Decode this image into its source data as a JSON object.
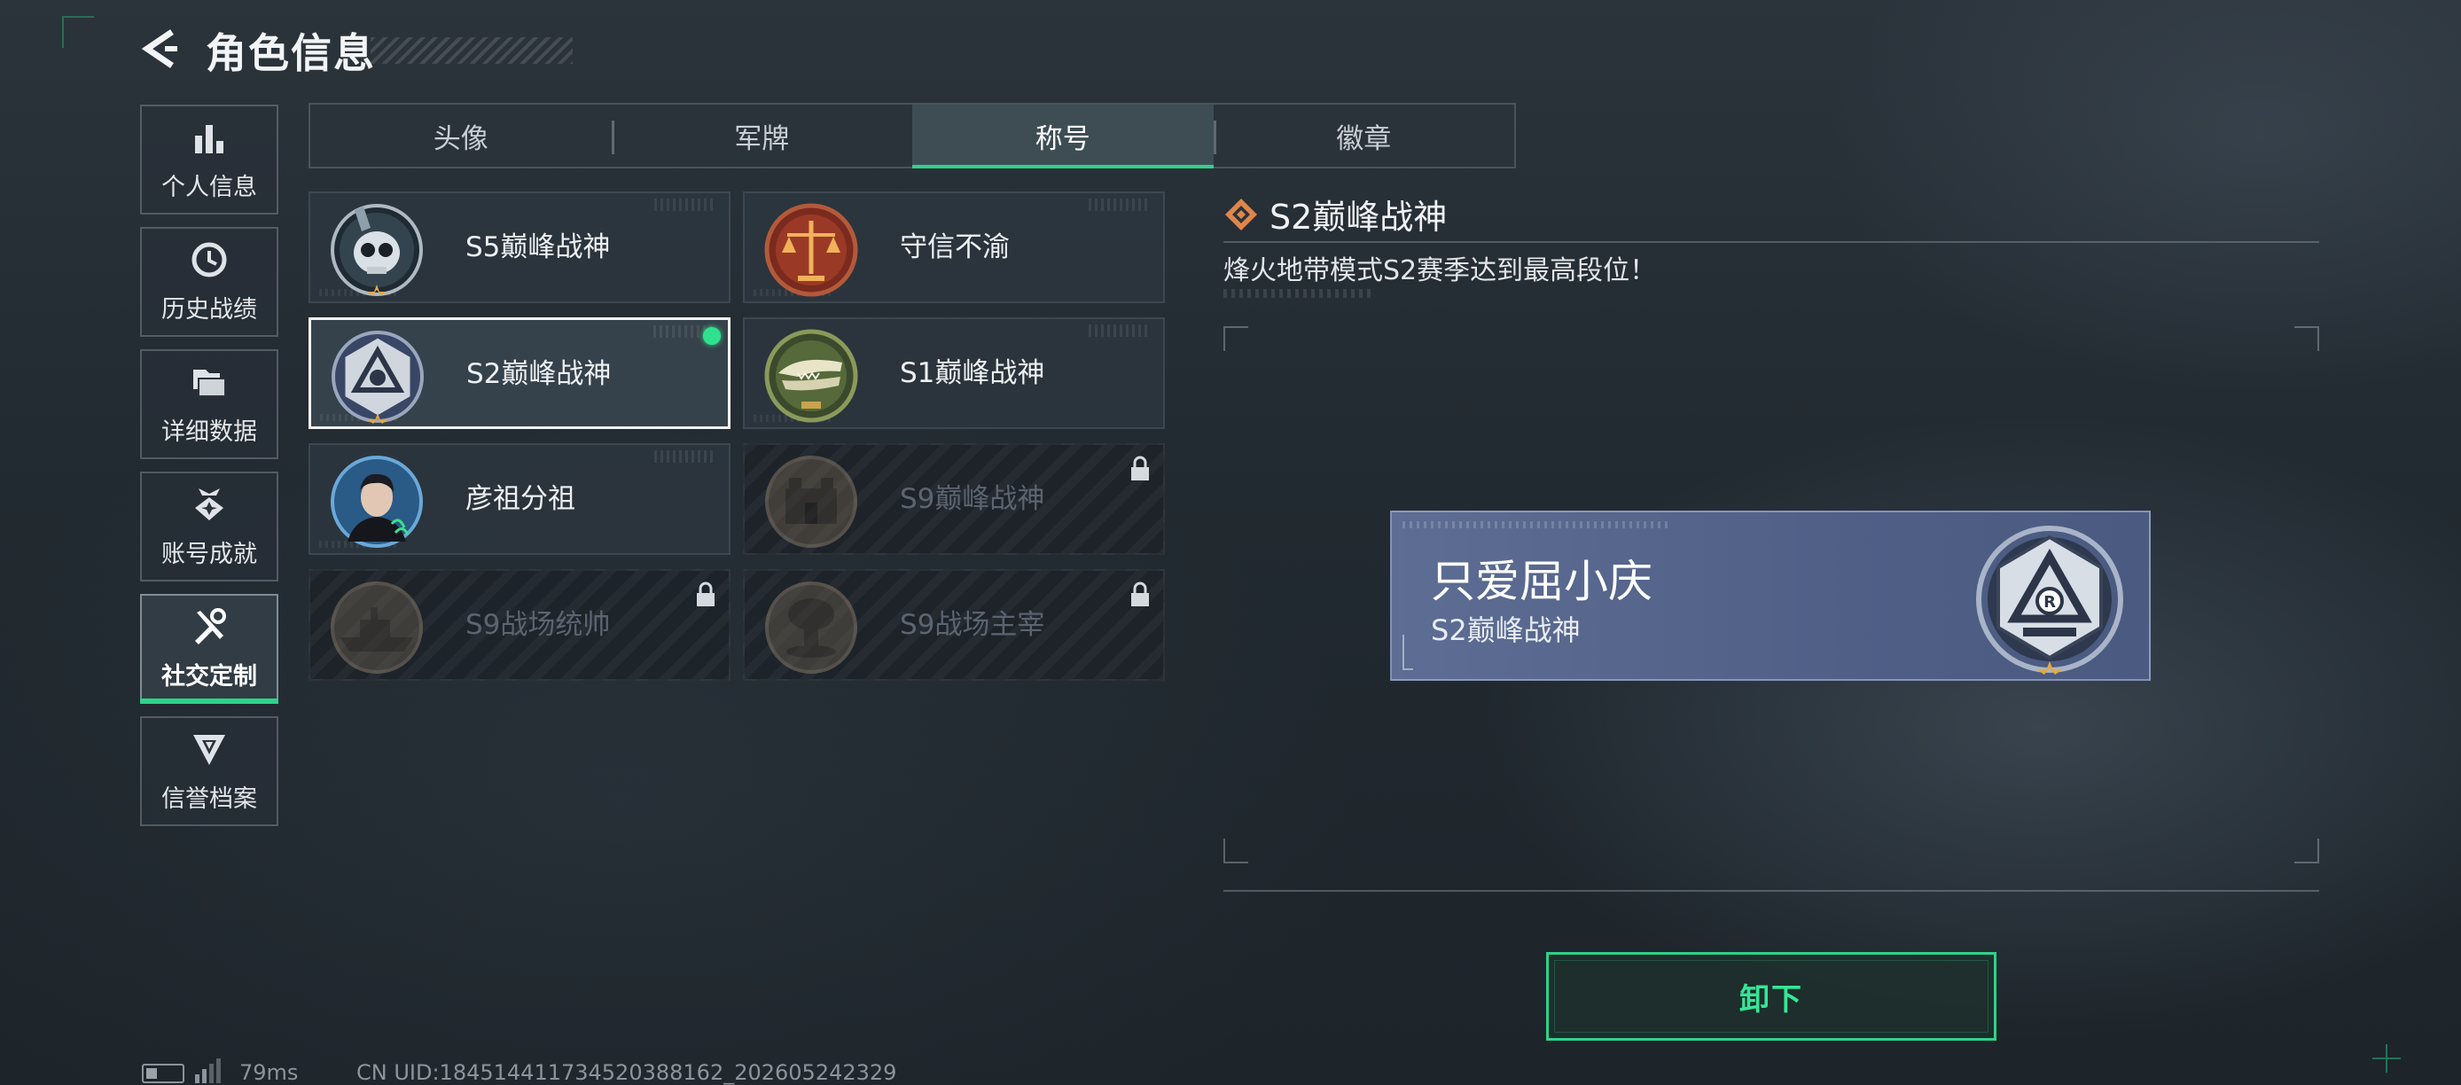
{
  "header": {
    "title": "角色信息"
  },
  "sidebar": {
    "items": [
      {
        "label": "个人信息",
        "icon": "bar-chart-icon",
        "active": false
      },
      {
        "label": "历史战绩",
        "icon": "history-icon",
        "active": false
      },
      {
        "label": "详细数据",
        "icon": "folder-icon",
        "active": false
      },
      {
        "label": "账号成就",
        "icon": "achievement-icon",
        "active": false
      },
      {
        "label": "社交定制",
        "icon": "tools-icon",
        "active": true
      },
      {
        "label": "信誉档案",
        "icon": "credit-icon",
        "active": false
      }
    ]
  },
  "tabs": [
    {
      "label": "头像",
      "active": false
    },
    {
      "label": "军牌",
      "active": false
    },
    {
      "label": "称号",
      "active": true
    },
    {
      "label": "徽章",
      "active": false
    }
  ],
  "cards": [
    {
      "name": "S5巅峰战神",
      "emblem": "skull-helmet-emblem-icon",
      "selected": false,
      "equipped": false,
      "locked": false
    },
    {
      "name": "守信不渝",
      "emblem": "scales-emblem-icon",
      "selected": false,
      "equipped": false,
      "locked": false
    },
    {
      "name": "S2巅峰战神",
      "emblem": "triangle-emblem-icon",
      "selected": true,
      "equipped": true,
      "locked": false
    },
    {
      "name": "S1巅峰战神",
      "emblem": "crocodile-emblem-icon",
      "selected": false,
      "equipped": false,
      "locked": false
    },
    {
      "name": "彦祖分祖",
      "emblem": "portrait-emblem-icon",
      "selected": false,
      "equipped": false,
      "locked": false
    },
    {
      "name": "S9巅峰战神",
      "emblem": "fortress-emblem-icon",
      "selected": false,
      "equipped": false,
      "locked": true
    },
    {
      "name": "S9战场统帅",
      "emblem": "warship-emblem-icon",
      "selected": false,
      "equipped": false,
      "locked": true
    },
    {
      "name": "S9战场主宰",
      "emblem": "mushroom-cloud-emblem-icon",
      "selected": false,
      "equipped": false,
      "locked": true
    }
  ],
  "detail": {
    "title": "S2巅峰战神",
    "description": "烽火地带模式S2赛季达到最高段位！"
  },
  "preview": {
    "player_name": "只爱屈小庆",
    "title": "S2巅峰战神",
    "emblem_letter": "R"
  },
  "actions": {
    "unequip_label": "卸下"
  },
  "status": {
    "ping": "79ms",
    "uid": "CN UID:18451441173452038816​2_202605242329"
  },
  "colors": {
    "accent": "#2fd28a",
    "equipped_dot": "#2fe18e",
    "plate": "#5d6d93",
    "diamond": "#e0864a"
  }
}
